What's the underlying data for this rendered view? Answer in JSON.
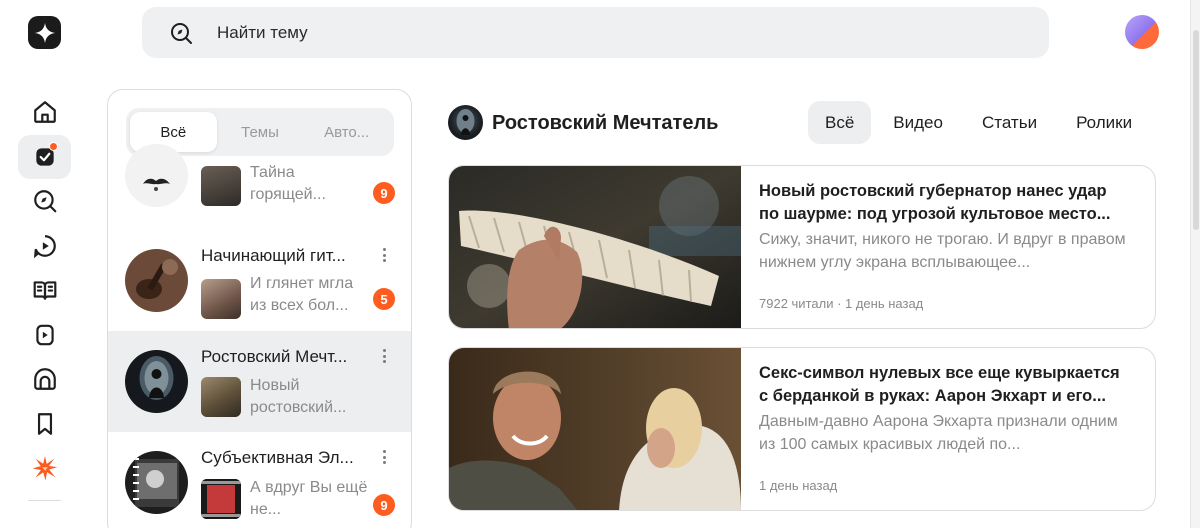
{
  "search": {
    "placeholder": "Найти тему"
  },
  "nav": {
    "items": [
      {
        "name": "home-icon",
        "active": false
      },
      {
        "name": "subscriptions-icon",
        "active": true,
        "dot": true
      },
      {
        "name": "discover-icon",
        "active": false
      },
      {
        "name": "video-icon",
        "active": false
      },
      {
        "name": "articles-icon",
        "active": false
      },
      {
        "name": "clips-icon",
        "active": false
      },
      {
        "name": "studio-icon",
        "active": false
      },
      {
        "name": "bookmark-icon",
        "active": false
      },
      {
        "name": "promo-icon",
        "active": false
      }
    ]
  },
  "subscriptions": {
    "tabs": [
      "Всё",
      "Темы",
      "Авто..."
    ],
    "active_tab": 0,
    "items": [
      {
        "name": "",
        "snippet": "Тайна горящей...",
        "badge": "9"
      },
      {
        "name": "Начинающий гит...",
        "snippet": "И глянет мгла из всех бол...",
        "badge": "5"
      },
      {
        "name": "Ростовский Мечт...",
        "snippet": "Новый ростовский...",
        "badge": ""
      },
      {
        "name": "Субъективная Эл...",
        "snippet": "А вдруг Вы ещё не...",
        "badge": "9"
      }
    ]
  },
  "channel": {
    "title": "Ростовский Мечтатель",
    "tabs": [
      "Всё",
      "Видео",
      "Статьи",
      "Ролики"
    ],
    "active_tab": 0
  },
  "articles": [
    {
      "title": "Новый ростовский губернатор нанес удар по шаурме: под угрозой культовое место...",
      "desc": "Сижу, значит, никого не трогаю. И вдруг в правом нижнем углу экрана всплывающее...",
      "meta": "7922 читали · 1 день назад"
    },
    {
      "title": "Секс-символ нулевых все еще кувыркается с берданкой в руках: Аарон Экхарт и его...",
      "desc": "Давным-давно Аарона Экхарта признали одним из 100 самых красивых людей по...",
      "meta": "1 день назад"
    }
  ],
  "colors": {
    "accent": "#ff5c1f",
    "surface": "#eff0f2",
    "active": "#eceef0",
    "muted": "#8a8a8a"
  }
}
